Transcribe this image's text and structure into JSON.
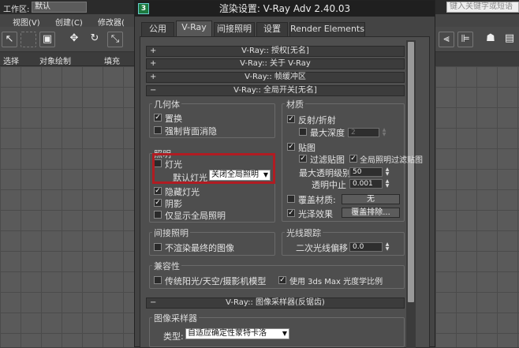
{
  "background": {
    "workspace_label": "工作区:",
    "workspace_value": "默认",
    "menu": [
      "视图(V)",
      "创建(C)",
      "修改器("
    ],
    "cmd_strip": [
      "选择",
      "对象绘制",
      "填充"
    ],
    "search_placeholder": "键入关键字或短语"
  },
  "dialog": {
    "title": "渲染设置: V-Ray Adv 2.40.03",
    "icon_text": "3",
    "tabs": [
      "公用",
      "V-Ray",
      "间接照明",
      "设置",
      "Render Elements"
    ],
    "rollouts": {
      "license": "V-Ray:: 授权[无名]",
      "about": "V-Ray:: 关于 V-Ray",
      "framebuffer": "V-Ray:: 帧缓冲区",
      "global_switches": "V-Ray:: 全局开关[无名]",
      "image_sampler": "V-Ray:: 图像采样器(反锯齿)"
    },
    "geometry": {
      "title": "几何体",
      "displacement": "置换",
      "force_backface": "强制背面消隐"
    },
    "lighting": {
      "title": "照明",
      "lights": "灯光",
      "default_lights_label": "默认灯光",
      "default_lights_value": "关闭全局照明",
      "hidden_lights": "隐藏灯光",
      "shadows": "阴影",
      "show_gi_only": "仅显示全局照明"
    },
    "materials": {
      "title": "材质",
      "reflect_refract": "反射/折射",
      "max_depth": "最大深度",
      "max_depth_value": "2",
      "maps": "贴图",
      "filter_maps": "过滤贴图",
      "filter_maps_gi": "全局照明过滤贴图",
      "max_transp_levels": "最大透明级别",
      "max_transp_value": "50",
      "transp_cutoff": "透明中止",
      "transp_cutoff_value": "0.001",
      "override_mtl": "覆盖材质:",
      "override_mtl_btn": "无",
      "glossy_effects": "光泽效果",
      "override_exclude_btn": "覆盖排除..."
    },
    "indirect": {
      "title": "间接照明",
      "dont_render_final": "不渲染最终的图像"
    },
    "raytracing": {
      "title": "光线跟踪",
      "secondary_bias": "二次光线偏移",
      "secondary_bias_value": "0.0"
    },
    "compatibility": {
      "title": "兼容性",
      "legacy_sun": "传统阳光/天空/摄影机模型",
      "use_3dsmax_scale": "使用 3ds Max 光度学比例"
    },
    "image_sampler": {
      "title": "图像采样器",
      "type_label": "类型:",
      "type_value": "自适应确定性蒙特卡洛"
    }
  }
}
